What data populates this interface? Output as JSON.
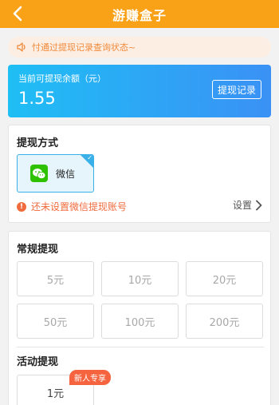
{
  "header": {
    "title": "游赚盒子",
    "back_icon": "chevron-left-icon"
  },
  "notice": {
    "icon": "speaker-icon",
    "text": "忖通过提现记录查询状态~"
  },
  "balance": {
    "label": "当前可提现余额（元）",
    "amount": "1.55",
    "record_button": "提现记录"
  },
  "method": {
    "title": "提现方式",
    "options": [
      {
        "label": "微信",
        "icon": "wechat-icon",
        "selected": true
      }
    ],
    "warning": "还未设置微信提现账号",
    "setting_label": "设置"
  },
  "regular": {
    "title": "常规提现",
    "amounts": [
      "5元",
      "10元",
      "20元",
      "50元",
      "100元",
      "200元"
    ]
  },
  "activity": {
    "title": "活动提现",
    "amount": "1元",
    "badge": "新人专享"
  },
  "colors": {
    "header": "#f9a217",
    "accent_blue": "#3ab0e8",
    "warning": "#f06b3e",
    "notice_text": "#f08a3a"
  }
}
